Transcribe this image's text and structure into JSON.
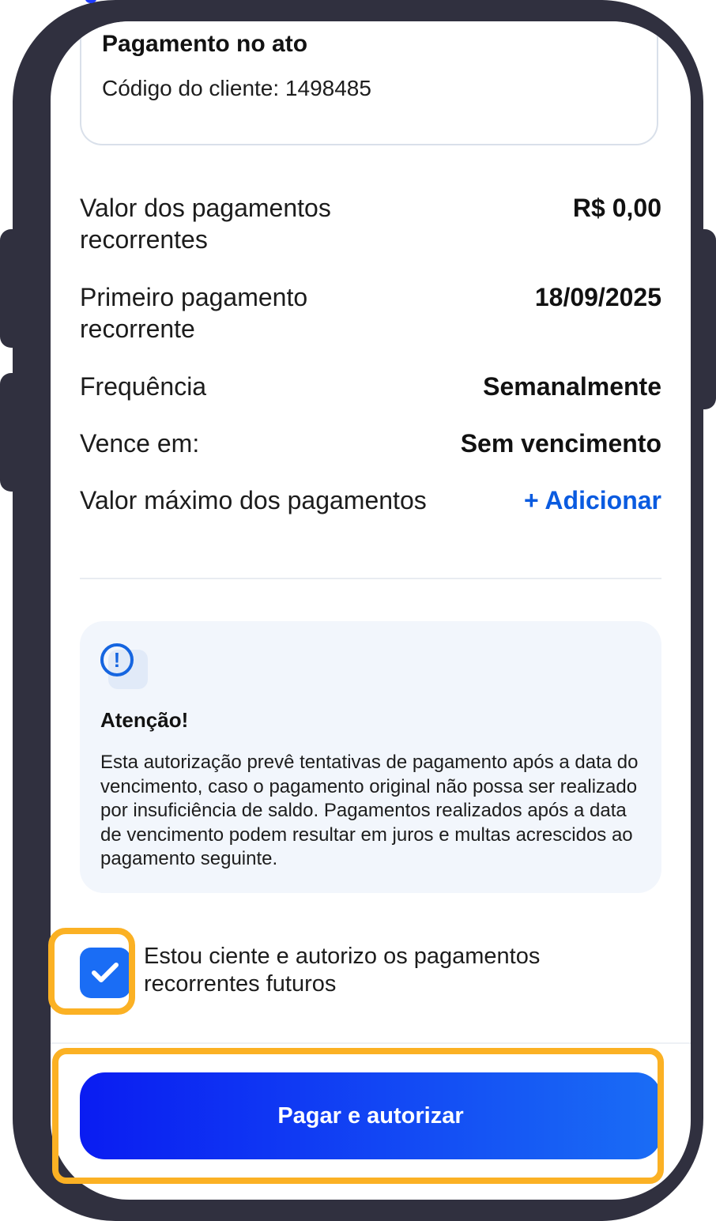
{
  "payment_card": {
    "title": "Pagamento no ato",
    "client_code": "Código do cliente: 1498485"
  },
  "details": [
    {
      "label": "Valor dos pagamentos recorrentes",
      "value": "R$ 0,00"
    },
    {
      "label": "Primeiro pagamento recorrente",
      "value": "18/09/2025"
    },
    {
      "label": "Frequência",
      "value": "Semanalmente"
    },
    {
      "label": "Vence em:",
      "value": "Sem vencimento"
    },
    {
      "label": "Valor máximo dos pagamentos",
      "value": "+ Adicionar"
    }
  ],
  "alert": {
    "icon": "exclamation-circle-icon",
    "icon_glyph": "!",
    "title": "Atenção!",
    "text": "Esta autorização prevê tentativas de pagamento após a data do vencimento, caso o pagamento original não possa ser realizado por insuficiência de saldo. Pagamentos realizados após a data de vencimento podem resultar em juros e multas acrescidos ao pagamento seguinte."
  },
  "consent": {
    "checked": true,
    "text": "Estou ciente e autorizo os pagamentos recorrentes futuros"
  },
  "primary_button": {
    "label": "Pagar e autorizar"
  },
  "colors": {
    "accent": "#1a6df5",
    "link": "#0a5be0",
    "highlight": "#fbb124",
    "frame": "#30303f"
  }
}
